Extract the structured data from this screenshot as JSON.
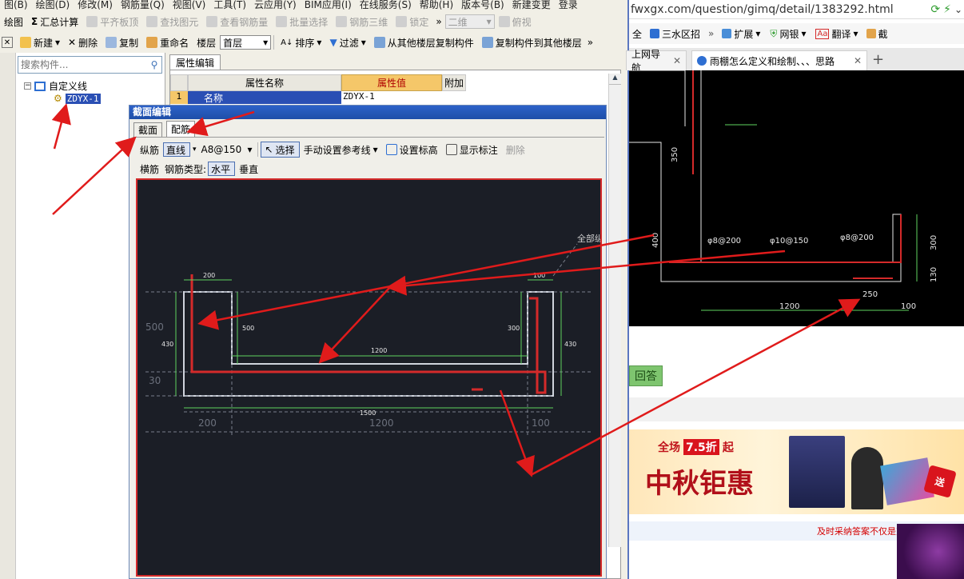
{
  "menubar": {
    "items": [
      "图(B)",
      "绘图(D)",
      "修改(M)",
      "钢筋量(Q)",
      "视图(V)",
      "工具(T)",
      "云应用(Y)",
      "BIM应用(I)",
      "在线服务(S)",
      "帮助(H)",
      "版本号(B)",
      "新建变更",
      "登录"
    ]
  },
  "toolbar1": {
    "draw_label": "绘图",
    "sum_label": "汇总计算",
    "flat_top_label": "平齐板顶",
    "find_label": "查找图元",
    "view_rebar_label": "查看钢筋量",
    "batch_select_label": "批量选择",
    "rebar3d_label": "钢筋三维",
    "lock_label": "锁定",
    "view_mode": "二维",
    "perspective_label": "俯视"
  },
  "toolbar2": {
    "new_label": "新建",
    "delete_label": "删除",
    "copy_label": "复制",
    "rename_label": "重命名",
    "floor_label": "楼层",
    "floor_value": "首层",
    "sort_label": "排序",
    "filter_label": "过滤",
    "copy_from_label": "从其他楼层复制构件",
    "copy_to_label": "复制构件到其他楼层"
  },
  "left_panel": {
    "search_placeholder": "搜索构件...",
    "tree_root": "自定义线",
    "tree_child": "ZDYX-1"
  },
  "property_panel": {
    "tab_label": "属性编辑",
    "col_name": "属性名称",
    "col_value": "属性值",
    "col_extra": "附加",
    "rows": [
      {
        "index": "1",
        "name": "名称",
        "value": "ZDYX-1"
      }
    ]
  },
  "dialog": {
    "title": "截面编辑",
    "tabs": [
      "截面",
      "配筋"
    ],
    "row1": {
      "longitudinal_label": "纵筋",
      "line_mode": "直线",
      "spec": "A8@150",
      "select_label": "选择",
      "manual_ref_label": "手动设置参考线",
      "set_height_label": "设置标高",
      "show_dim_label": "显示标注",
      "delete_label": "删除"
    },
    "row2": {
      "transverse_label": "横筋",
      "type_label": "钢筋类型:",
      "horizontal_label": "水平",
      "vertical_label": "垂直"
    },
    "canvas": {
      "dims": [
        "200",
        "100",
        "500",
        "300",
        "1200",
        "430",
        "430",
        "500",
        "30",
        "1500",
        "200",
        "1200",
        "100",
        "全部纵"
      ]
    }
  },
  "browser": {
    "url": "fwxgx.com/question/gimq/detail/1383292.html",
    "fav": [
      "全",
      "三水区招",
      "扩展",
      "网银",
      "翻译",
      "截"
    ],
    "tabs": [
      "上网导航",
      "雨棚怎么定义和绘制、、、思路"
    ],
    "cad_labels": [
      "350",
      "400",
      "φ8@200",
      "φ10@150",
      "φ8@200",
      "300",
      "130",
      "1200",
      "250",
      "100"
    ],
    "answer_btn": "回答",
    "banner": {
      "promo_prefix": "全场",
      "discount": "7.5折",
      "promo_suffix": "起",
      "headline": "中秋钜惠",
      "badge": "送"
    },
    "notice": "及时采纳答案不仅是对回答者的认可"
  },
  "colors": {
    "accent_red": "#d42a2a",
    "cad_bg": "#1b1e26",
    "green_dim": "#5fd35f",
    "title_blue": "#2d62c9"
  }
}
